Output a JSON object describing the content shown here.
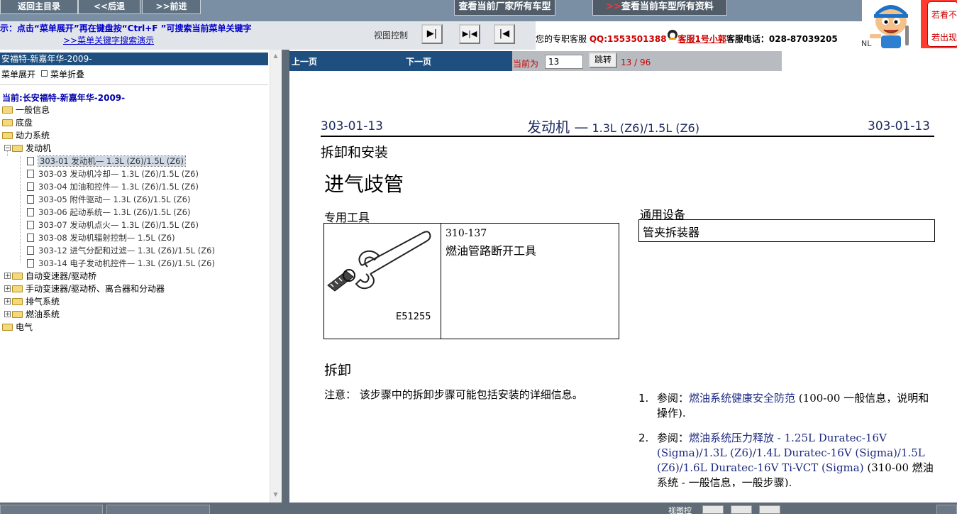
{
  "toolbar": {
    "home_label": "返回主目录",
    "back_label": "<<后退",
    "forward_label": ">>前进",
    "all_models_label": "查看当前厂家所有车型",
    "all_docs_arrows": ">>",
    "all_docs_label": "查看当前车型所有资料"
  },
  "hint": {
    "line1": "示：点击“菜单展开”再在键盘按“Ctrl+F ”可搜索当前菜单关键字",
    "line2": ">>菜单关键字搜索演示"
  },
  "view_control": {
    "label": "视图控制",
    "buttons": [
      "▶|",
      "▶|◀",
      "|◀"
    ]
  },
  "service": {
    "prefix": "您的专职客服",
    "qq": "QQ:1553501388",
    "agent": "客服1号小郭",
    "phone_label": "客服电话：028-87039205"
  },
  "side_ad": {
    "line1": "若看不",
    "line2": "若出现",
    "nl": "NL"
  },
  "tree_panel": {
    "title": "安福特-新嘉年华-2009-",
    "expand_label": "菜单展开",
    "collapse_label": "菜单折叠",
    "current_label": "当前:长安福特-新嘉年华-2009-",
    "nodes": [
      {
        "label": "一般信息"
      },
      {
        "label": "底盘"
      },
      {
        "label": "动力系统"
      },
      {
        "label": "发动机"
      },
      {
        "label": "303-01 发动机— 1.3L (Z6)/1.5L (Z6)"
      },
      {
        "label": "303-03 发动机冷却— 1.3L (Z6)/1.5L (Z6)"
      },
      {
        "label": "303-04 加油和控件— 1.3L (Z6)/1.5L (Z6)"
      },
      {
        "label": "303-05 附件驱动— 1.3L (Z6)/1.5L (Z6)"
      },
      {
        "label": "303-06 起动系统— 1.3L (Z6)/1.5L (Z6)"
      },
      {
        "label": "303-07 发动机点火— 1.3L (Z6)/1.5L (Z6)"
      },
      {
        "label": "303-08 发动机辐射控制— 1.5L (Z6)"
      },
      {
        "label": "303-12 进气分配和过滤— 1.3L (Z6)/1.5L (Z6)"
      },
      {
        "label": "303-14 电子发动机控件— 1.3L (Z6)/1.5L (Z6)"
      },
      {
        "label": "自动变速器/驱动桥"
      },
      {
        "label": "手动变速器/驱动桥、离合器和分动器"
      },
      {
        "label": "排气系统"
      },
      {
        "label": "燃油系统"
      },
      {
        "label": "电气"
      }
    ]
  },
  "pager": {
    "prev_label": "上一页",
    "next_label": "下一页",
    "current_label": "当前为",
    "current_value": "13",
    "jump_label": "跳转",
    "count": "13 / 96"
  },
  "document": {
    "header_left": "303-01-13",
    "header_center_main": "发动机 —",
    "header_center_sub": " 1.3L (Z6)/1.5L (Z6)",
    "header_right": "303-01-13",
    "section_title": "拆卸和安装",
    "procedure_title": "进气歧管",
    "special_tools_label": "专用工具",
    "tool_code": "310-137",
    "tool_name": "燃油管路断开工具",
    "tool_image_label": "E51255",
    "general_equipment_label": "通用设备",
    "equipment_name": "管夹拆装器",
    "removal_title": "拆卸",
    "note_label": "注意：",
    "note_text": "  该步骤中的拆卸步骤可能包括安装的详细信息。",
    "steps": [
      {
        "num": "1.",
        "prefix": "参阅：",
        "link": "燃油系统健康安全防范",
        "suffix": "(100-00 一般信息，说明和操作)."
      },
      {
        "num": "2.",
        "prefix": "参阅：",
        "link": "燃油系统压力释放 - 1.25L Duratec-16V (Sigma)/1.3L (Z6)/1.4L Duratec-16V (Sigma)/1.5L (Z6)/1.6L Duratec-16V Ti-VCT (Sigma)",
        "suffix": "(310-00 燃油系统 - 一般信息，一般步骤)."
      }
    ]
  },
  "bottom": {
    "view_label": "视图控"
  }
}
